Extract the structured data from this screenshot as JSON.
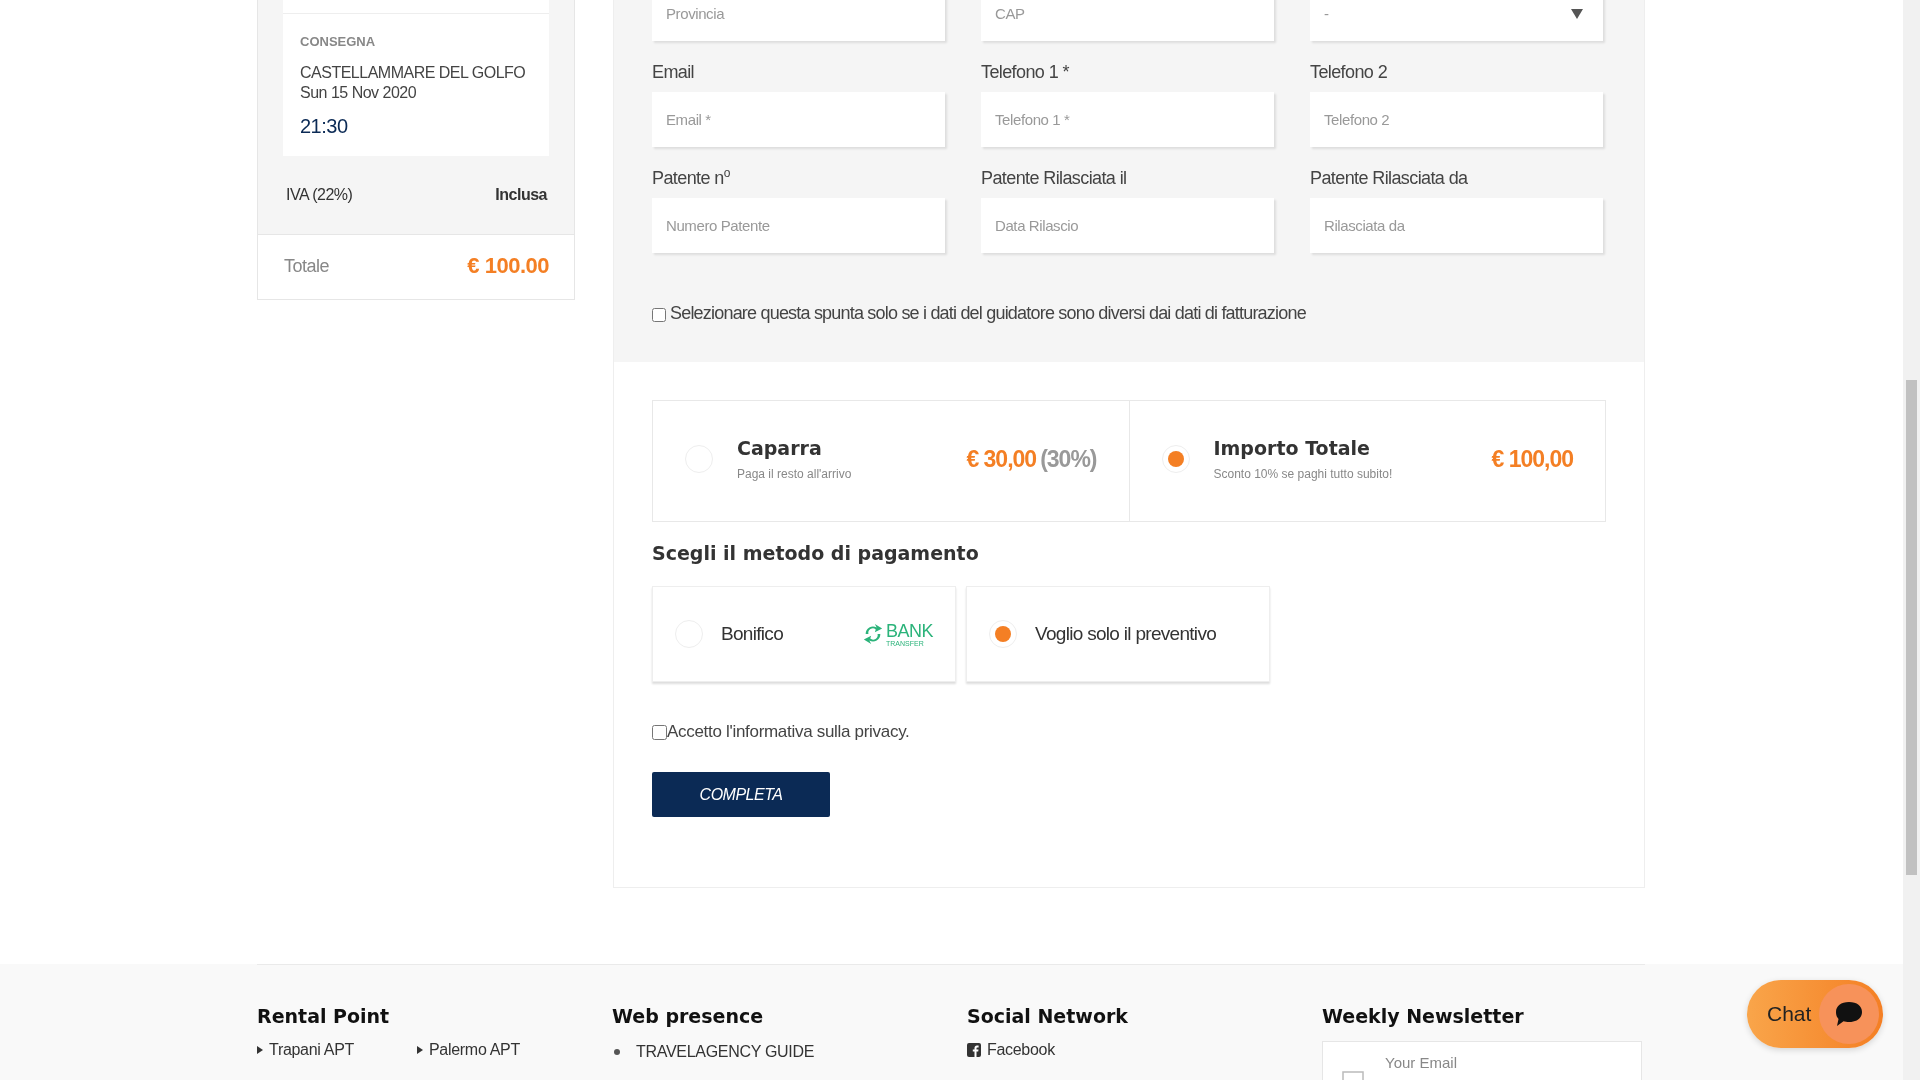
{
  "sidebar": {
    "delivery": {
      "label": "CONSEGNA",
      "place": "CASTELLAMMARE DEL GOLFO",
      "date": "Sun 15 Nov 2020",
      "time": "21:30"
    },
    "tax": {
      "label": "IVA (22%)",
      "value": "Inclusa"
    },
    "total": {
      "label": "Totale",
      "value": "€ 100.00"
    }
  },
  "form": {
    "rows": [
      [
        {
          "kind": "text",
          "placeholder": "Provincia"
        },
        {
          "kind": "text",
          "placeholder": "CAP"
        },
        {
          "kind": "select",
          "placeholder": "-"
        }
      ],
      [
        {
          "kind": "text",
          "label": "Email",
          "placeholder": "Email *"
        },
        {
          "kind": "text",
          "label": "Telefono 1 *",
          "placeholder": "Telefono 1 *"
        },
        {
          "kind": "text",
          "label": "Telefono 2",
          "placeholder": "Telefono 2"
        }
      ],
      [
        {
          "kind": "text",
          "label": "Patente n$^{o}$",
          "placeholder": "Numero Patente"
        },
        {
          "kind": "text",
          "label": "Patente Rilasciata il",
          "placeholder": "Data Rilascio"
        },
        {
          "kind": "text",
          "label": "Patente Rilasciata da",
          "placeholder": "Rilasciata da"
        }
      ]
    ],
    "driver_checkbox": {
      "label": "Selezionare questa spunta solo se i dati del guidatore sono diversi dai dati di fatturazione",
      "checked": false
    }
  },
  "amount_options": [
    {
      "title": "Caparra",
      "subtitle": "Paga il resto all'arrivo",
      "amount": "€ 30,00",
      "percent": "(30%)",
      "selected": false
    },
    {
      "title": "Importo Totale",
      "subtitle": "Sconto 10% se paghi tutto subito!",
      "amount": "€ 100,00",
      "selected": true
    }
  ],
  "payment": {
    "title": "Scegli il metodo di pagamento",
    "methods": [
      {
        "label": "Bonifico",
        "logo": "BANK",
        "logo_sub": "TRANSFER",
        "selected": false
      },
      {
        "label": "Voglio solo il preventivo",
        "selected": true
      }
    ]
  },
  "privacy": {
    "label": "Accetto l'informativa sulla privacy.",
    "checked": false
  },
  "submit": "COMPLETA",
  "footer": {
    "columns": [
      {
        "kind": "arrow-list",
        "title": "Rental Point",
        "items": [
          "Trapani APT",
          "Palermo APT"
        ]
      },
      {
        "kind": "bullet-list",
        "title": "Web presence",
        "items": [
          "TRAVELAGENCY GUIDE"
        ]
      },
      {
        "kind": "social-list",
        "title": "Social Network",
        "items": [
          "Facebook"
        ]
      },
      {
        "kind": "newsletter",
        "title": "Weekly Newsletter",
        "placeholder": "Your Email"
      }
    ]
  },
  "chat": {
    "label": "Chat"
  }
}
